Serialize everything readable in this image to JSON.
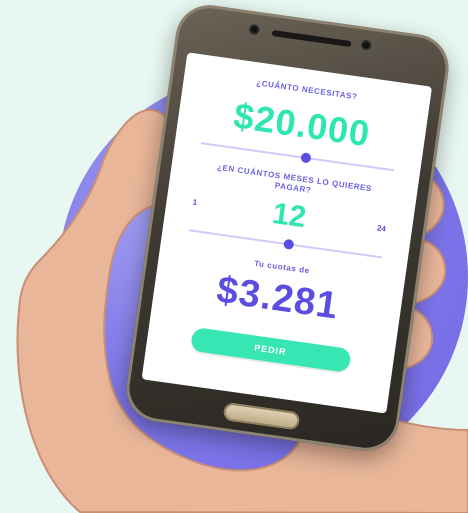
{
  "screen": {
    "q1": "¿Cuánto necesitas?",
    "amount": "$20.000",
    "q2": "¿En cuántos meses lo quieres pagar?",
    "months_min": "1",
    "months": "12",
    "months_max": "24",
    "q3": "Tu cuotas de",
    "fee": "$3.281",
    "button": "PEDIR"
  },
  "sliders": {
    "amount_level": 0.55,
    "months_level": 0.52
  },
  "colors": {
    "background": "#e8f7f1",
    "accent_purple": "#6a5fe2",
    "accent_green": "#2ee6b0"
  }
}
